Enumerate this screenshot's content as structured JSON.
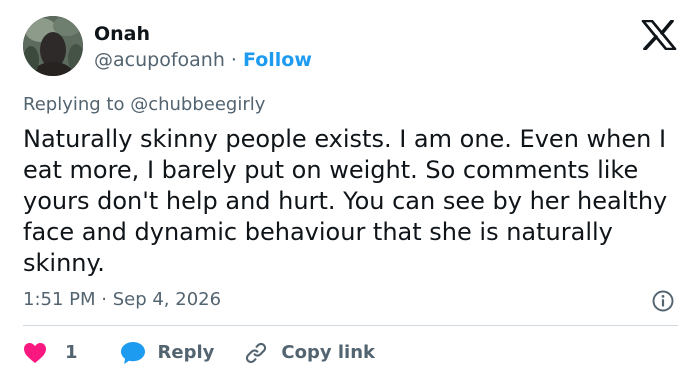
{
  "author": {
    "name": "Onah",
    "handle": "@acupofoanh",
    "separator": "·",
    "follow_label": "Follow"
  },
  "reply_context": {
    "prefix": "Replying to",
    "target_handle": "@chubbeegirly"
  },
  "tweet": {
    "text": "Naturally skinny people exists. I am one. Even when I eat more, I barely put on weight. So comments like yours don't help and hurt. You can see by her healthy face and dynamic behaviour that she is naturally skinny.",
    "timestamp": "1:51 PM · Sep 4, 2026"
  },
  "actions": {
    "like_count": "1",
    "reply_label": "Reply",
    "copy_link_label": "Copy link"
  },
  "colors": {
    "text_primary": "#0f1419",
    "text_secondary": "#536471",
    "link_blue": "#1d9bf0",
    "like_red": "#f91880",
    "divider": "#cfd9de"
  },
  "icons": {
    "brand": "x-logo-icon",
    "info": "info-icon",
    "like": "heart-icon",
    "reply": "speech-bubble-icon",
    "copy_link": "link-icon"
  }
}
